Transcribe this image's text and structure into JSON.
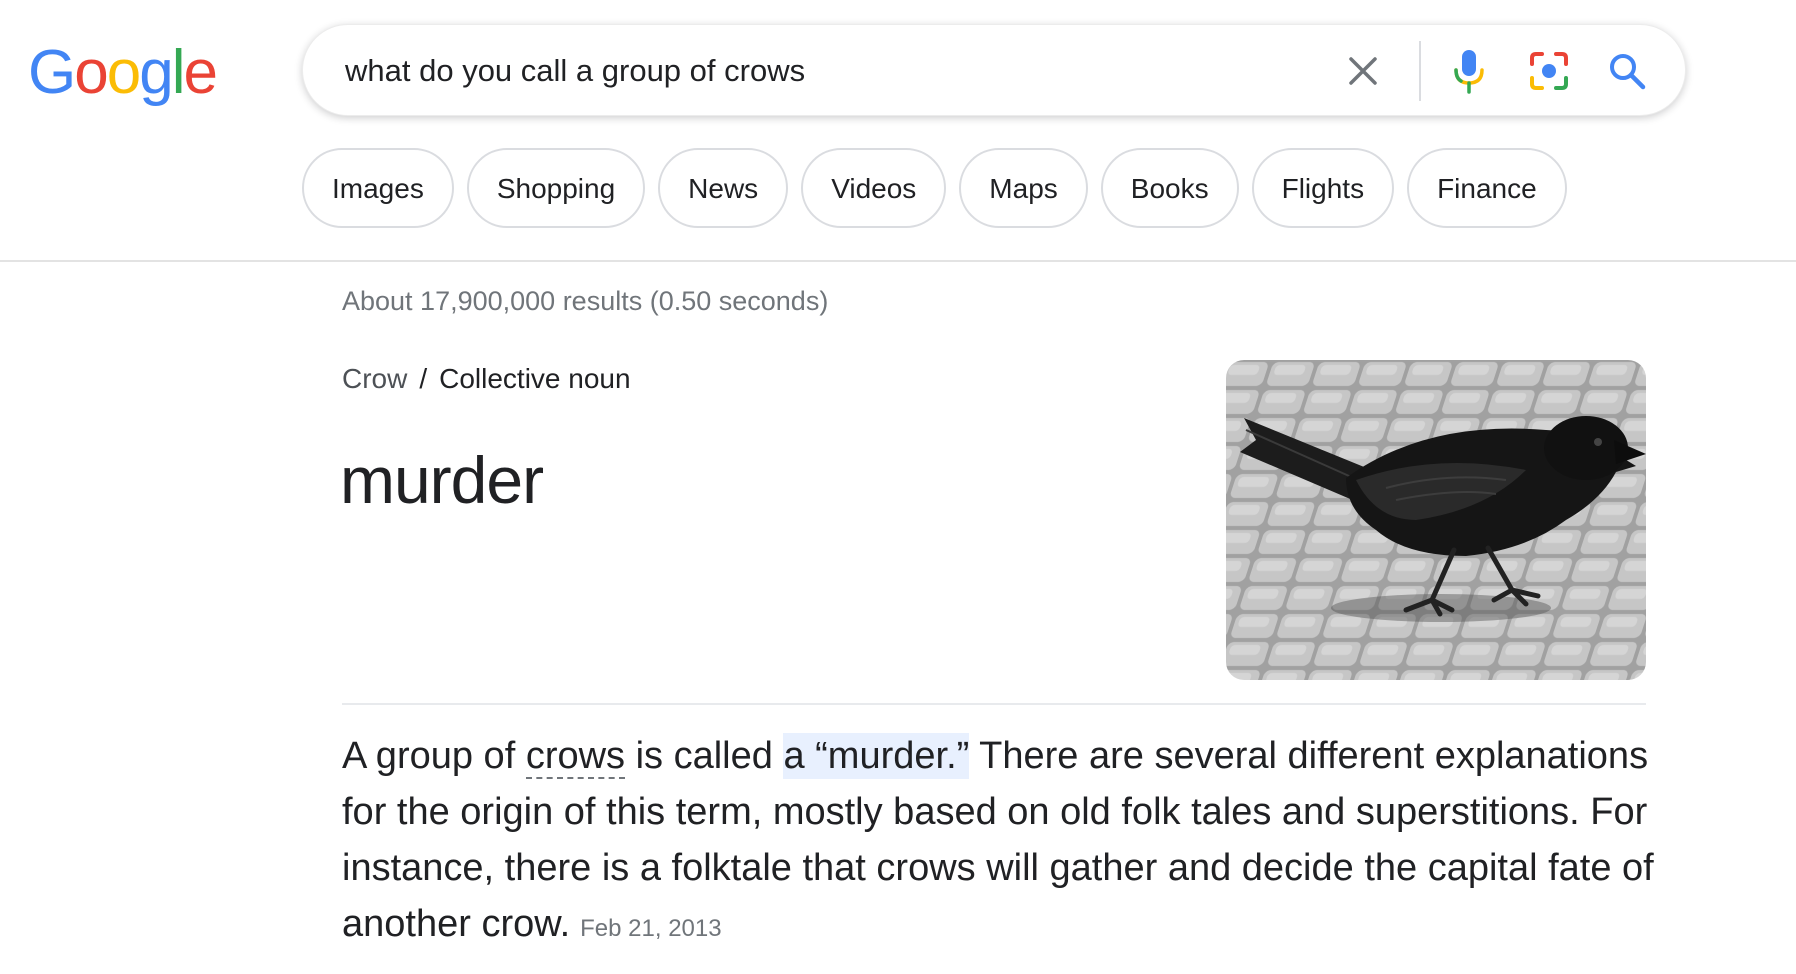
{
  "logo": {
    "letters": [
      {
        "ch": "G",
        "color": "#4285F4"
      },
      {
        "ch": "o",
        "color": "#EA4335"
      },
      {
        "ch": "o",
        "color": "#FBBC05"
      },
      {
        "ch": "g",
        "color": "#4285F4"
      },
      {
        "ch": "l",
        "color": "#34A853"
      },
      {
        "ch": "e",
        "color": "#EA4335"
      }
    ]
  },
  "search": {
    "value": "what do you call a group of crows",
    "icons": [
      "close-icon",
      "microphone-icon",
      "camera-lens-icon",
      "search-icon"
    ]
  },
  "chips": [
    "Images",
    "Shopping",
    "News",
    "Videos",
    "Maps",
    "Books",
    "Flights",
    "Finance"
  ],
  "stats": "About 17,900,000 results (0.50 seconds)",
  "breadcrumb": {
    "link": "Crow",
    "separator": "/",
    "current": "Collective noun"
  },
  "answer": "murder",
  "snippet": {
    "part1": "A group of ",
    "link": "crows",
    "part2": " is called ",
    "highlight": "a “murder.”",
    "part3": " There are several different explanations for the origin of this term, mostly based on old folk tales and superstitions. For instance, there is a folktale that crows will gather and decide the capital fate of another crow.",
    "date": "Feb 21, 2013"
  },
  "colors": {
    "accent_blue": "#4285F4",
    "highlight": "#e8f0fe",
    "muted_text": "#70757a"
  }
}
